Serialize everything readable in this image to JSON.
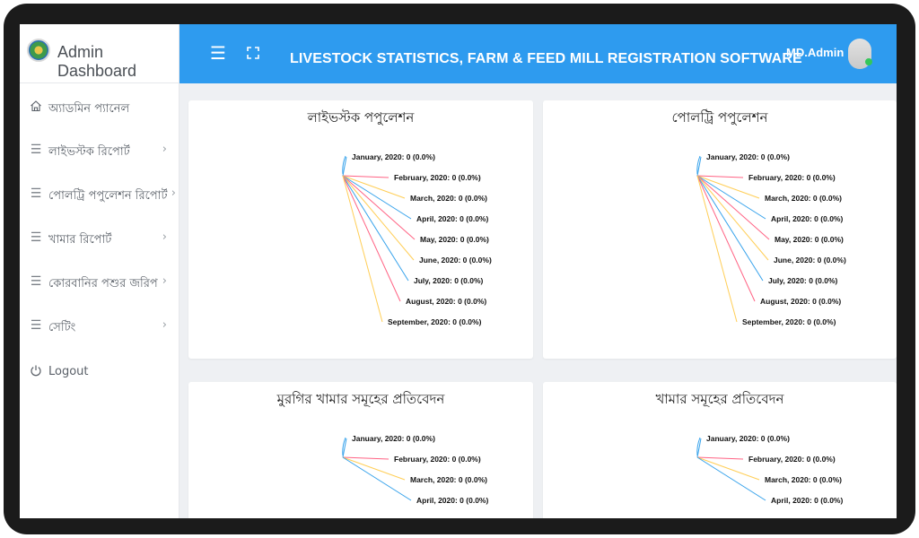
{
  "sidebar": {
    "brand": "Admin Dashboard",
    "items": [
      {
        "label": "অ্যাডমিন প্যানেল",
        "icon": "home-icon",
        "has_children": false
      },
      {
        "label": "লাইভস্টক রিপোর্ট",
        "icon": "menu-lines-icon",
        "has_children": true
      },
      {
        "label": "পোলট্রি পপুলেশন রিপোর্ট",
        "icon": "menu-lines-icon",
        "has_children": true
      },
      {
        "label": "খামার রিপোর্ট",
        "icon": "menu-lines-icon",
        "has_children": true
      },
      {
        "label": "কোরবানির পশুর জরিপ",
        "icon": "menu-lines-icon",
        "has_children": true
      },
      {
        "label": "সেটিং",
        "icon": "menu-lines-icon",
        "has_children": true
      },
      {
        "label": "Logout",
        "icon": "power-icon",
        "has_children": false
      }
    ]
  },
  "header": {
    "menu_icon": "hamburger-icon",
    "fullscreen_icon": "fullscreen-icon",
    "title": "LIVESTOCK STATISTICS, FARM & FEED MILL REGISTRATION SOFTWARE",
    "user": "MD.Admin",
    "accent": "#2e9bef"
  },
  "chart_colors": [
    "#36a2eb",
    "#ff6384",
    "#ffce56"
  ],
  "chart_data": [
    {
      "type": "pie",
      "title": "লাইভস্টক পপুলেশন",
      "labels": [
        "January, 2020: 0 (0.0%)",
        "February, 2020: 0 (0.0%)",
        "March, 2020: 0 (0.0%)",
        "April, 2020: 0 (0.0%)",
        "May, 2020: 0 (0.0%)",
        "June, 2020: 0 (0.0%)",
        "July, 2020: 0 (0.0%)",
        "August, 2020: 0 (0.0%)",
        "September, 2020: 0 (0.0%)"
      ],
      "values": [
        0,
        0,
        0,
        0,
        0,
        0,
        0,
        0,
        0
      ]
    },
    {
      "type": "pie",
      "title": "পোলট্রি পপুলেশন",
      "labels": [
        "January, 2020: 0 (0.0%)",
        "February, 2020: 0 (0.0%)",
        "March, 2020: 0 (0.0%)",
        "April, 2020: 0 (0.0%)",
        "May, 2020: 0 (0.0%)",
        "June, 2020: 0 (0.0%)",
        "July, 2020: 0 (0.0%)",
        "August, 2020: 0 (0.0%)",
        "September, 2020: 0 (0.0%)"
      ],
      "values": [
        0,
        0,
        0,
        0,
        0,
        0,
        0,
        0,
        0
      ]
    },
    {
      "type": "pie",
      "title": "মুরগির খামার সমূহের প্রতিবেদন",
      "labels": [
        "January, 2020: 0 (0.0%)",
        "February, 2020: 0 (0.0%)",
        "March, 2020: 0 (0.0%)",
        "April, 2020: 0 (0.0%)"
      ],
      "values": [
        0,
        0,
        0,
        0
      ]
    },
    {
      "type": "pie",
      "title": "খামার সমূহের প্রতিবেদন",
      "labels": [
        "January, 2020: 0 (0.0%)",
        "February, 2020: 0 (0.0%)",
        "March, 2020: 0 (0.0%)",
        "April, 2020: 0 (0.0%)"
      ],
      "values": [
        0,
        0,
        0,
        0
      ]
    }
  ]
}
